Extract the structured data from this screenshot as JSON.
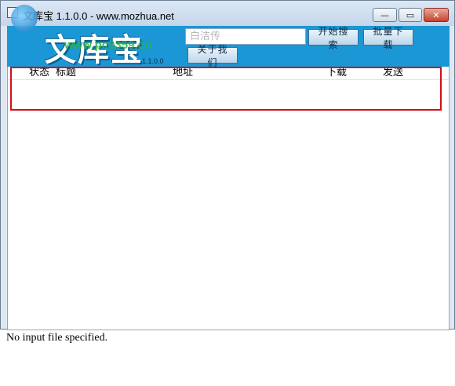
{
  "window": {
    "title": "文库宝 1.1.0.0 - www.mozhua.net",
    "buttons": {
      "minimize": "—",
      "maximize": "▭",
      "close": "✕"
    }
  },
  "header": {
    "logo_text": "文库宝",
    "logo_version": "1.1.0.0",
    "search": {
      "value": "",
      "placeholder": "白洁传"
    },
    "button_1_label": "开始搜索",
    "button_2_label": "批量下载",
    "button_3_label": "关于我们"
  },
  "table": {
    "columns": [
      "状态",
      "标题",
      "地址",
      "下载",
      "发送"
    ],
    "rows": []
  },
  "status": {
    "message": "No input file specified."
  },
  "watermark": {
    "text": "www.pc0359.cn"
  },
  "colors": {
    "header_bg": "#1b97d5",
    "highlight": "#d0101a"
  }
}
